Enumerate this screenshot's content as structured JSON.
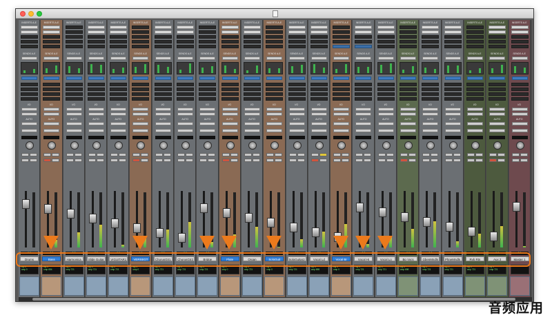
{
  "caption": "音频应用",
  "sections": {
    "inserts": "INSERTS A-E",
    "sends": "SENDS A-E",
    "io": "I/O",
    "auto": "AUTO",
    "group": "no group"
  },
  "tracks": [
    {
      "name": "Drums",
      "color": "gray",
      "volume": "0.0",
      "delay": [
        "dly 0",
        "cmp 0"
      ]
    },
    {
      "name": "Bass",
      "color": "orange",
      "volume": "0.0",
      "highlight": true,
      "delay": [
        "dly 0",
        "cmp 654"
      ]
    },
    {
      "name": "Harmonica",
      "color": "gray",
      "volume": "0.0",
      "delay": [
        "dly 0",
        "cmp 721"
      ]
    },
    {
      "name": "Slide Guitar",
      "color": "gray",
      "volume": "0.0",
      "delay": [
        "dly 0",
        "cmp 721"
      ]
    },
    {
      "name": "VrGUITAR1",
      "color": "gray",
      "volume": "0.0",
      "delay": [
        "dly 0",
        "cmp 721"
      ]
    },
    {
      "name": "VERSEGT",
      "color": "orange",
      "volume": "0.0",
      "highlight": true,
      "delay": [
        "dly 0",
        "cmp 0"
      ]
    },
    {
      "name": "ChorusGtr1",
      "color": "gray",
      "volume": "0.0",
      "delay": [
        "dly 0",
        "cmp 721"
      ]
    },
    {
      "name": "ChorusGtr2",
      "color": "gray",
      "volume": "0.0",
      "delay": [
        "dly 0",
        "cmp 721"
      ]
    },
    {
      "name": "Bridge",
      "color": "gray",
      "volume": "0.0",
      "delay": [
        "dly 0",
        "cmp 721"
      ]
    },
    {
      "name": "Flute",
      "color": "orange",
      "volume": "0.0",
      "highlight": true,
      "delay": [
        "dly 0",
        "cmp 0"
      ]
    },
    {
      "name": "Organ",
      "color": "gray",
      "volume": "0.0",
      "delay": [
        "dly 0",
        "cmp 721"
      ]
    },
    {
      "name": "SoloGuit",
      "color": "orange",
      "volume": "0.0",
      "highlight": true,
      "delay": [
        "dly 0",
        "cmp 0"
      ]
    },
    {
      "name": "SoloGuitar2",
      "color": "gray",
      "volume": "0.0",
      "delay": [
        "dly 0",
        "cmp 721"
      ]
    },
    {
      "name": "Vocal Ld",
      "color": "gray",
      "volume": "0.0",
      "delay": [
        "dly 0",
        "cmp 698"
      ]
    },
    {
      "name": "Vocal Br",
      "color": "orange",
      "volume": "0.0",
      "highlight": true,
      "delay": [
        "dly 0",
        "cmp 0"
      ]
    },
    {
      "name": "Vocal Hi",
      "color": "gray",
      "volume": "0.0",
      "delay": [
        "dly 0",
        "cmp 721"
      ]
    },
    {
      "name": "Vocal Lo",
      "color": "gray",
      "volume": "0.0",
      "delay": [
        "dly 0",
        "cmp 721"
      ]
    },
    {
      "name": "Bg Vocs",
      "color": "green",
      "volume": "0.0",
      "delay": [
        "dly 0",
        "cmp 698"
      ]
    },
    {
      "name": "GbenMndln",
      "color": "gray",
      "volume": "0.0",
      "delay": [
        "dly 0",
        "cmp 721"
      ]
    },
    {
      "name": "PhneMndln",
      "color": "gray",
      "volume": "0.0",
      "delay": [
        "dly 0",
        "cmp 721"
      ]
    },
    {
      "name": "Rvb Rtn",
      "color": "darkgreen",
      "volume": "0.0",
      "delay": [
        "dly 0",
        "cmp 721"
      ]
    },
    {
      "name": "Aux 2",
      "color": "darkgreen",
      "volume": "0.0",
      "delay": [
        "dly 0",
        "cmp 721"
      ]
    },
    {
      "name": "Master 1",
      "color": "master",
      "volume": "0.0",
      "delay": [
        "",
        ""
      ]
    }
  ],
  "arrows_on_tracks": [
    1,
    5,
    8,
    9,
    11,
    14,
    15,
    16
  ]
}
